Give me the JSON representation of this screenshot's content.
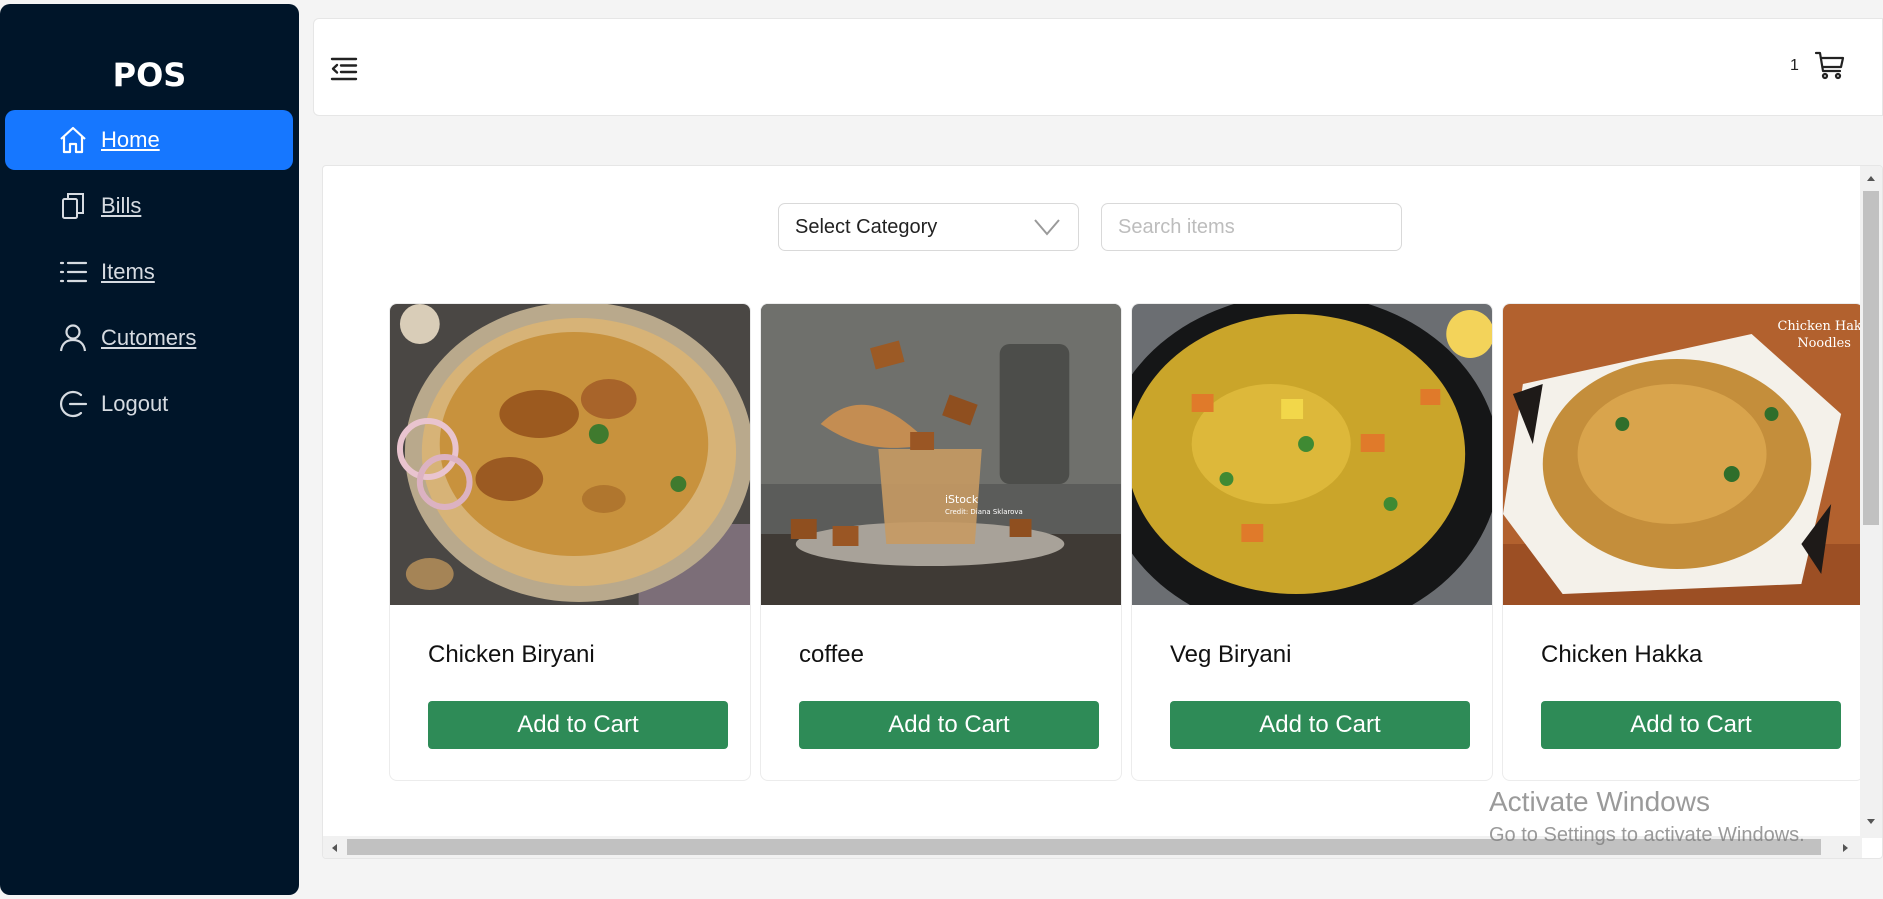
{
  "sidebar": {
    "brand": "POS",
    "items": [
      {
        "label": "Home",
        "icon": "home-icon",
        "active": true
      },
      {
        "label": "Bills",
        "icon": "copy-icon"
      },
      {
        "label": "Items",
        "icon": "list-icon"
      },
      {
        "label": "Cutomers",
        "icon": "user-icon"
      },
      {
        "label": "Logout",
        "icon": "logout-icon"
      }
    ]
  },
  "header": {
    "menu_icon": "menu-fold-icon",
    "cart_count": "1",
    "cart_icon": "shopping-cart-icon"
  },
  "filters": {
    "category_selected": "Select Category",
    "search_placeholder": "Search items"
  },
  "products": [
    {
      "name": "Chicken Biryani",
      "button": "Add to Cart"
    },
    {
      "name": "coffee",
      "button": "Add to Cart",
      "image_text": [
        "iStock",
        "Credit: Diana Sklarova"
      ]
    },
    {
      "name": "Veg Biryani",
      "button": "Add to Cart"
    },
    {
      "name": "Chicken Hakka",
      "button": "Add to Cart",
      "image_text": [
        "Chicken Hakka",
        "Noodles"
      ]
    }
  ],
  "watermark": {
    "line1": "Activate Windows",
    "line2": "Go to Settings to activate Windows."
  },
  "colors": {
    "sidebar_bg": "#001529",
    "active_nav": "#1677ff",
    "add_button": "#2e8b57"
  }
}
